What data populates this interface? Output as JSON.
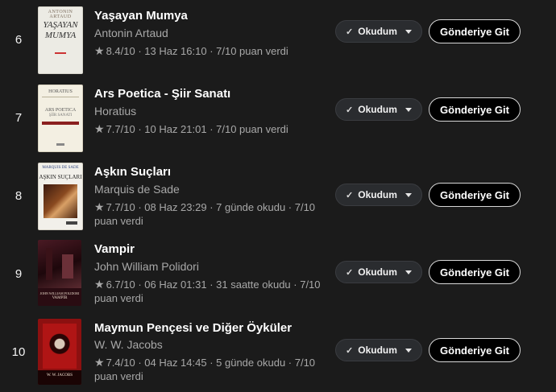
{
  "items": [
    {
      "rank": "6",
      "title": "Yaşayan Mumya",
      "author": "Antonin Artaud",
      "meta": "8.4/10 · 13 Haz 16:10 · 7/10 puan verdi",
      "status": "Okudum",
      "action": "Gönderiye Git",
      "cover_text": [
        "ANTONIN ARTAUD",
        "YAŞAYAN",
        "MUMYA"
      ]
    },
    {
      "rank": "7",
      "title": "Ars Poetica - Şiir Sanatı",
      "author": "Horatius",
      "meta": "7.7/10 · 10 Haz 21:01 · 7/10 puan verdi",
      "status": "Okudum",
      "action": "Gönderiye Git",
      "cover_text": [
        "HORATIUS",
        "ARS POETICA",
        "ŞİİR SANATI"
      ]
    },
    {
      "rank": "8",
      "title": "Aşkın Suçları",
      "author": "Marquis de Sade",
      "meta": "7.7/10 · 08 Haz 23:29 · 7 günde okudu · 7/10 puan verdi",
      "status": "Okudum",
      "action": "Gönderiye Git",
      "cover_text": [
        "MARQUIS DE SADE",
        "AŞKIN SUÇLARI"
      ]
    },
    {
      "rank": "9",
      "title": "Vampir",
      "author": "John William Polidori",
      "meta": "6.7/10 · 06 Haz 01:31 · 31 saatte okudu · 7/10 puan verdi",
      "status": "Okudum",
      "action": "Gönderiye Git",
      "cover_text": [
        "JOHN WILLIAM POLIDORI",
        "VAMPİR"
      ]
    },
    {
      "rank": "10",
      "title": "Maymun Pençesi ve Diğer Öyküler",
      "author": "W. W. Jacobs",
      "meta": "7.4/10 · 04 Haz 14:45 · 5 günde okudu · 7/10 puan verdi",
      "status": "Okudum",
      "action": "Gönderiye Git",
      "cover_text": [
        "W. W. JACOBS"
      ]
    }
  ],
  "icons": {
    "star": "star-icon",
    "check": "check-icon",
    "caret": "caret-down-icon"
  },
  "colors": {
    "background": "#1b1b1b",
    "muted_text": "#a8a8a8",
    "button_bg": "#000000",
    "status_bg": "#2a2c2f"
  }
}
